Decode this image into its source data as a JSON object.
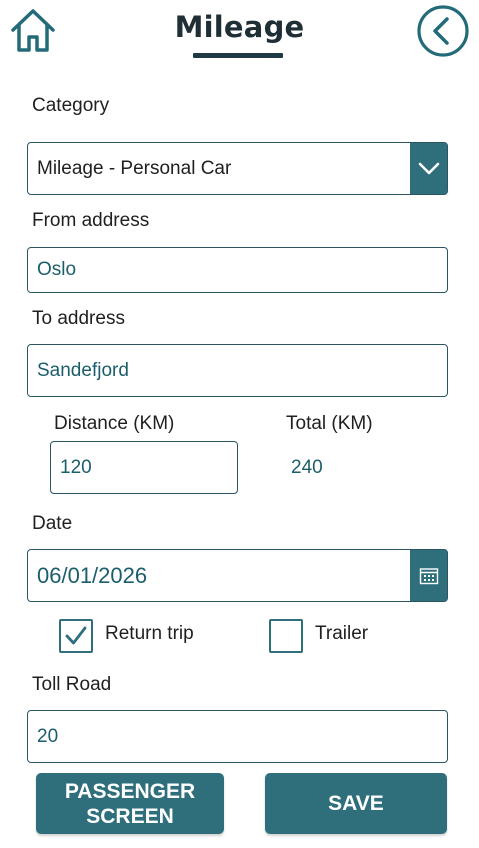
{
  "header": {
    "title": "Mileage",
    "home_icon": "home-icon",
    "back_icon": "chevron-left-circle-icon"
  },
  "form": {
    "category": {
      "label": "Category",
      "value": "Mileage - Personal Car",
      "icon": "chevron-down-icon"
    },
    "from_address": {
      "label": "From address",
      "value": "Oslo"
    },
    "to_address": {
      "label": "To address",
      "value": "Sandefjord"
    },
    "distance": {
      "label": "Distance (KM)",
      "value": "120"
    },
    "total": {
      "label": "Total (KM)",
      "value": "240"
    },
    "date": {
      "label": "Date",
      "value": "06/01/2026",
      "icon": "calendar-icon"
    },
    "return_trip": {
      "label": "Return trip",
      "checked": true
    },
    "trailer": {
      "label": "Trailer",
      "checked": false
    },
    "toll_road": {
      "label": "Toll Road",
      "value": "20"
    }
  },
  "buttons": {
    "passenger_line1": "PASSENGER",
    "passenger_line2": "SCREEN",
    "save": "SAVE"
  },
  "colors": {
    "accent": "#2f6f7c",
    "title": "#1f2f35",
    "field_text": "#1b5e6b"
  }
}
